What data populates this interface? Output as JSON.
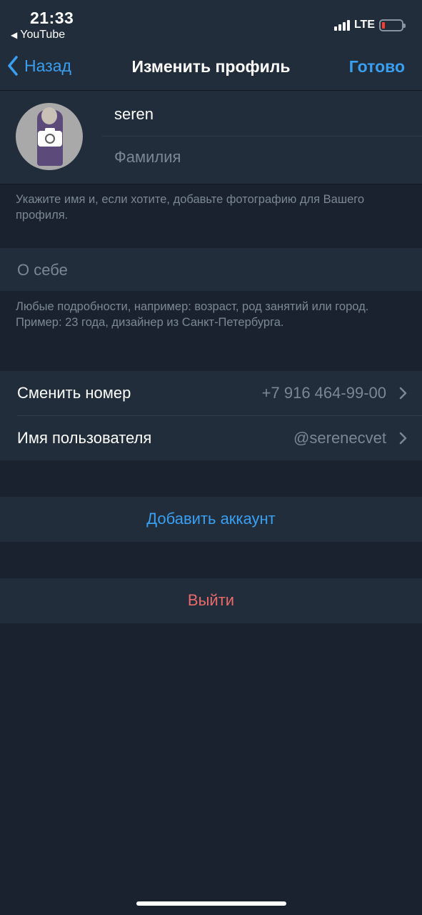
{
  "status_bar": {
    "time": "21:33",
    "back_app": "YouTube",
    "network": "LTE",
    "battery_level_percent": 10
  },
  "nav": {
    "back_label": "Назад",
    "title": "Изменить профиль",
    "done_label": "Готово"
  },
  "profile": {
    "first_name": "seren",
    "last_name_placeholder": "Фамилия",
    "hint": "Укажите имя и, если хотите, добавьте фотографию для Вашего профиля."
  },
  "bio": {
    "placeholder": "О себе",
    "hint_line1": "Любые подробности, например: возраст, род занятий или город.",
    "hint_line2": "Пример: 23 года, дизайнер из Санкт-Петербурга."
  },
  "settings_rows": [
    {
      "label": "Сменить номер",
      "value": "+7 916 464-99-00"
    },
    {
      "label": "Имя пользователя",
      "value": "@serenecvet"
    }
  ],
  "actions": {
    "add_account": "Добавить аккаунт",
    "logout": "Выйти"
  },
  "colors": {
    "accent": "#3a9ff0",
    "destructive": "#e96a6a",
    "background": "#1a2230",
    "cell_background": "#212d3b",
    "secondary_text": "#7b8794"
  }
}
